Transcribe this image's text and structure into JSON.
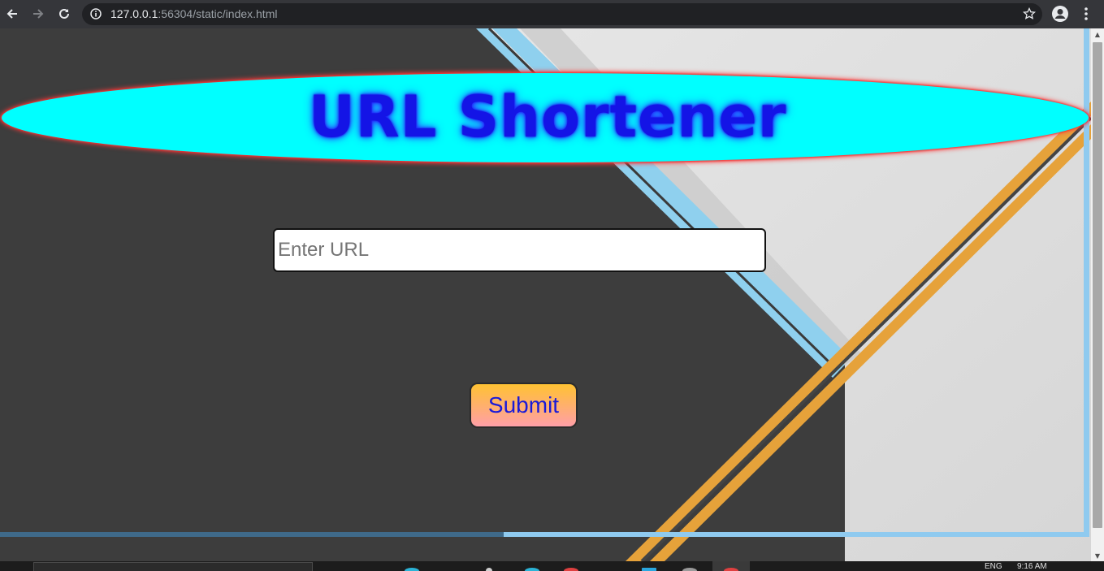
{
  "browser": {
    "url_host": "127.0.0.1",
    "url_rest": ":56304/static/index.html",
    "icons": [
      "back-icon",
      "forward-icon",
      "reload-icon",
      "info-icon",
      "star-icon",
      "profile-icon",
      "menu-dots-icon"
    ]
  },
  "page": {
    "title": "URL Shortener",
    "input_placeholder": "Enter URL",
    "input_value": "",
    "submit_label": "Submit",
    "colors": {
      "ellipse": "#00ffff",
      "title": "#1414e6",
      "page_bg": "#3d3d3d",
      "button_top": "#ffc233",
      "button_bottom": "#ff9fa8"
    }
  },
  "taskbar": {
    "lang": "ENG",
    "time": "9:16 AM"
  }
}
